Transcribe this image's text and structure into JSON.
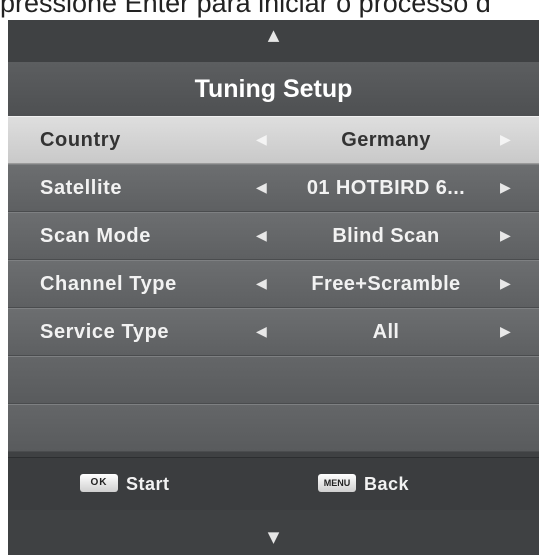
{
  "caption": "pressione Enter para iniciar o processo d",
  "menu": {
    "title": "Tuning Setup",
    "scroll_up": "▲",
    "scroll_down": "▼",
    "left_arrow": "◀",
    "right_arrow": "▶",
    "rows": [
      {
        "label": "Country",
        "value": "Germany",
        "selected": true
      },
      {
        "label": "Satellite",
        "value": "01 HOTBIRD 6...",
        "selected": false
      },
      {
        "label": "Scan Mode",
        "value": "Blind Scan",
        "selected": false
      },
      {
        "label": "Channel Type",
        "value": "Free+Scramble",
        "selected": false
      },
      {
        "label": "Service Type",
        "value": "All",
        "selected": false
      }
    ]
  },
  "footer": {
    "ok_key": "OK",
    "ok_label": "Start",
    "menu_key": "MENU",
    "menu_label": "Back"
  }
}
